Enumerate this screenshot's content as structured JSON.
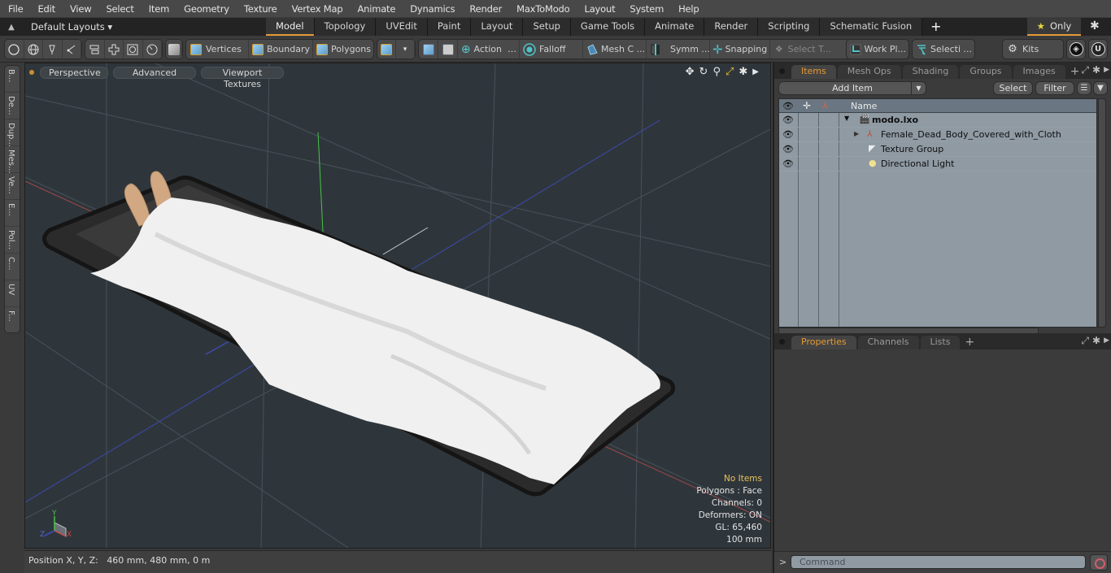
{
  "menu": [
    "File",
    "Edit",
    "View",
    "Select",
    "Item",
    "Geometry",
    "Texture",
    "Vertex Map",
    "Animate",
    "Dynamics",
    "Render",
    "MaxToModo",
    "Layout",
    "System",
    "Help"
  ],
  "layout_bar": {
    "layouts_label": "Default Layouts",
    "tabs": [
      "Model",
      "Topology",
      "UVEdit",
      "Paint",
      "Layout",
      "Setup",
      "Game Tools",
      "Animate",
      "Render",
      "Scripting",
      "Schematic Fusion"
    ],
    "active_tab": "Model",
    "only_label": "Only"
  },
  "toolbar": {
    "vertices": "Vertices",
    "boundary": "Boundary",
    "polygons": "Polygons",
    "action": "Action",
    "falloff": "Falloff",
    "mesh_c": "Mesh C ...",
    "symm": "Symm ...",
    "snapping": "Snapping",
    "select_t": "Select T...",
    "work_pl": "Work Pl...",
    "selecti": "Selecti ...",
    "kits": "Kits"
  },
  "left_strip": [
    "B...",
    "De...",
    "Dup...",
    "Mes...",
    "Ve...",
    "E...",
    "Pol...",
    "C...",
    "UV",
    "F..."
  ],
  "viewport": {
    "buttons": [
      "Perspective",
      "Advanced",
      "Viewport Textures"
    ],
    "info": {
      "items": "No Items",
      "polygons": "Polygons : Face",
      "channels": "Channels: 0",
      "deformers": "Deformers: ON",
      "gl": "GL: 65,460",
      "scale": "100 mm"
    },
    "axes": {
      "x": "X",
      "y": "Y",
      "z": "Z"
    }
  },
  "status_bar": {
    "position_label": "Position X, Y, Z:",
    "position_value": "460 mm, 480 mm, 0 m"
  },
  "items_panel": {
    "tabs": [
      "Items",
      "Mesh Ops",
      "Shading",
      "Groups",
      "Images"
    ],
    "active_tab": "Items",
    "add_item": "Add Item",
    "select": "Select",
    "filter": "Filter",
    "name_header": "Name",
    "tree": [
      {
        "label": "modo.lxo",
        "bold": true,
        "icon": "scene-icon"
      },
      {
        "label": "Female_Dead_Body_Covered_with_Cloth",
        "icon": "locator-icon"
      },
      {
        "label": "Texture Group",
        "icon": "texture-group-icon"
      },
      {
        "label": "Directional Light",
        "icon": "light-icon"
      }
    ]
  },
  "properties_panel": {
    "tabs": [
      "Properties",
      "Channels",
      "Lists"
    ],
    "active_tab": "Properties"
  },
  "command": {
    "placeholder": "Command"
  }
}
